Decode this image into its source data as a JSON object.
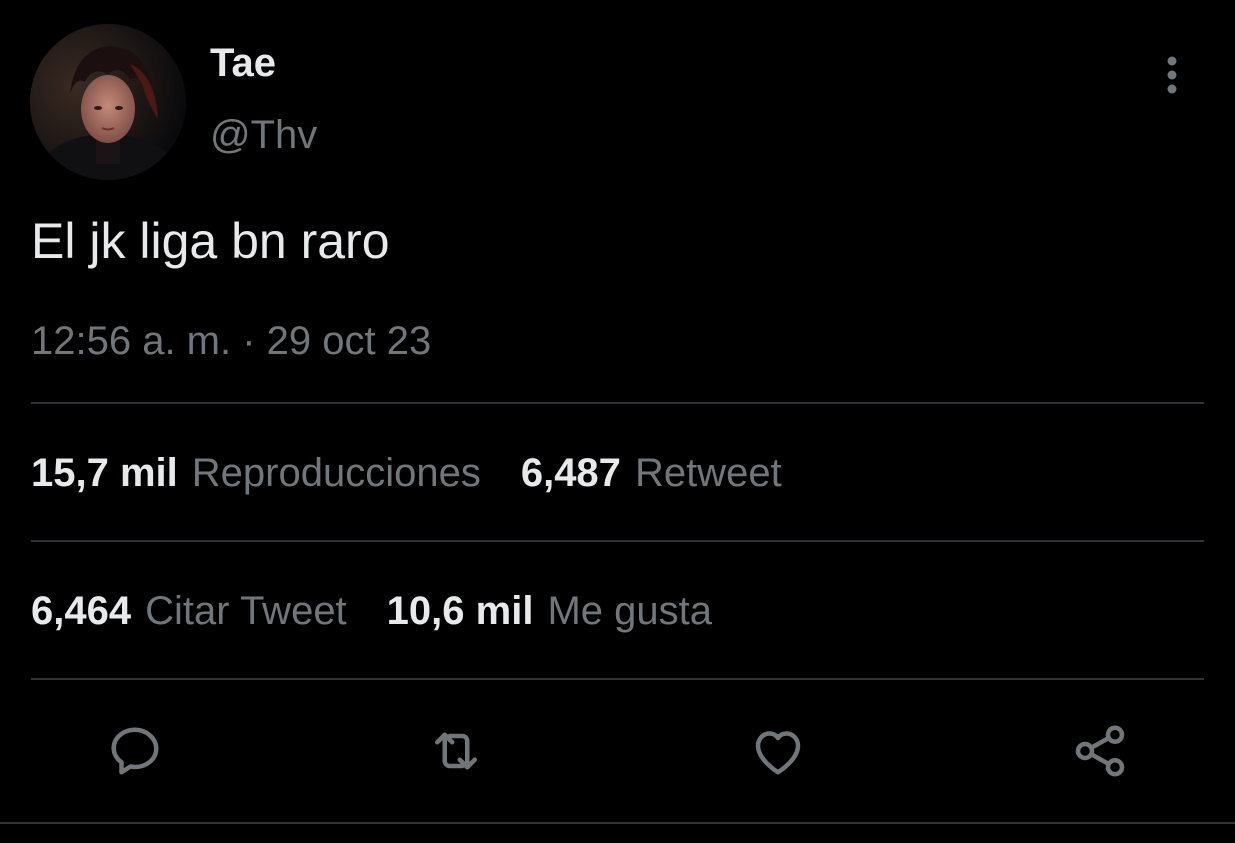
{
  "tweet": {
    "display_name": "Tae",
    "handle": "@Thv",
    "text": "El jk liga bn raro",
    "timestamp": "12:56 a. m. · 29 oct 23"
  },
  "stats": [
    {
      "value": "15,7 mil",
      "label": "Reproducciones"
    },
    {
      "value": "6,487",
      "label": "Retweet"
    },
    {
      "value": "6,464",
      "label": "Citar Tweet"
    },
    {
      "value": "10,6 mil",
      "label": "Me gusta"
    }
  ],
  "actions": {
    "reply_icon": "reply-icon",
    "retweet_icon": "retweet-icon",
    "like_icon": "heart-icon",
    "share_icon": "share-icon"
  },
  "colors": {
    "background": "#000000",
    "primary_text": "#e7e9ea",
    "secondary_text": "#71767b",
    "divider": "#2f3336"
  }
}
